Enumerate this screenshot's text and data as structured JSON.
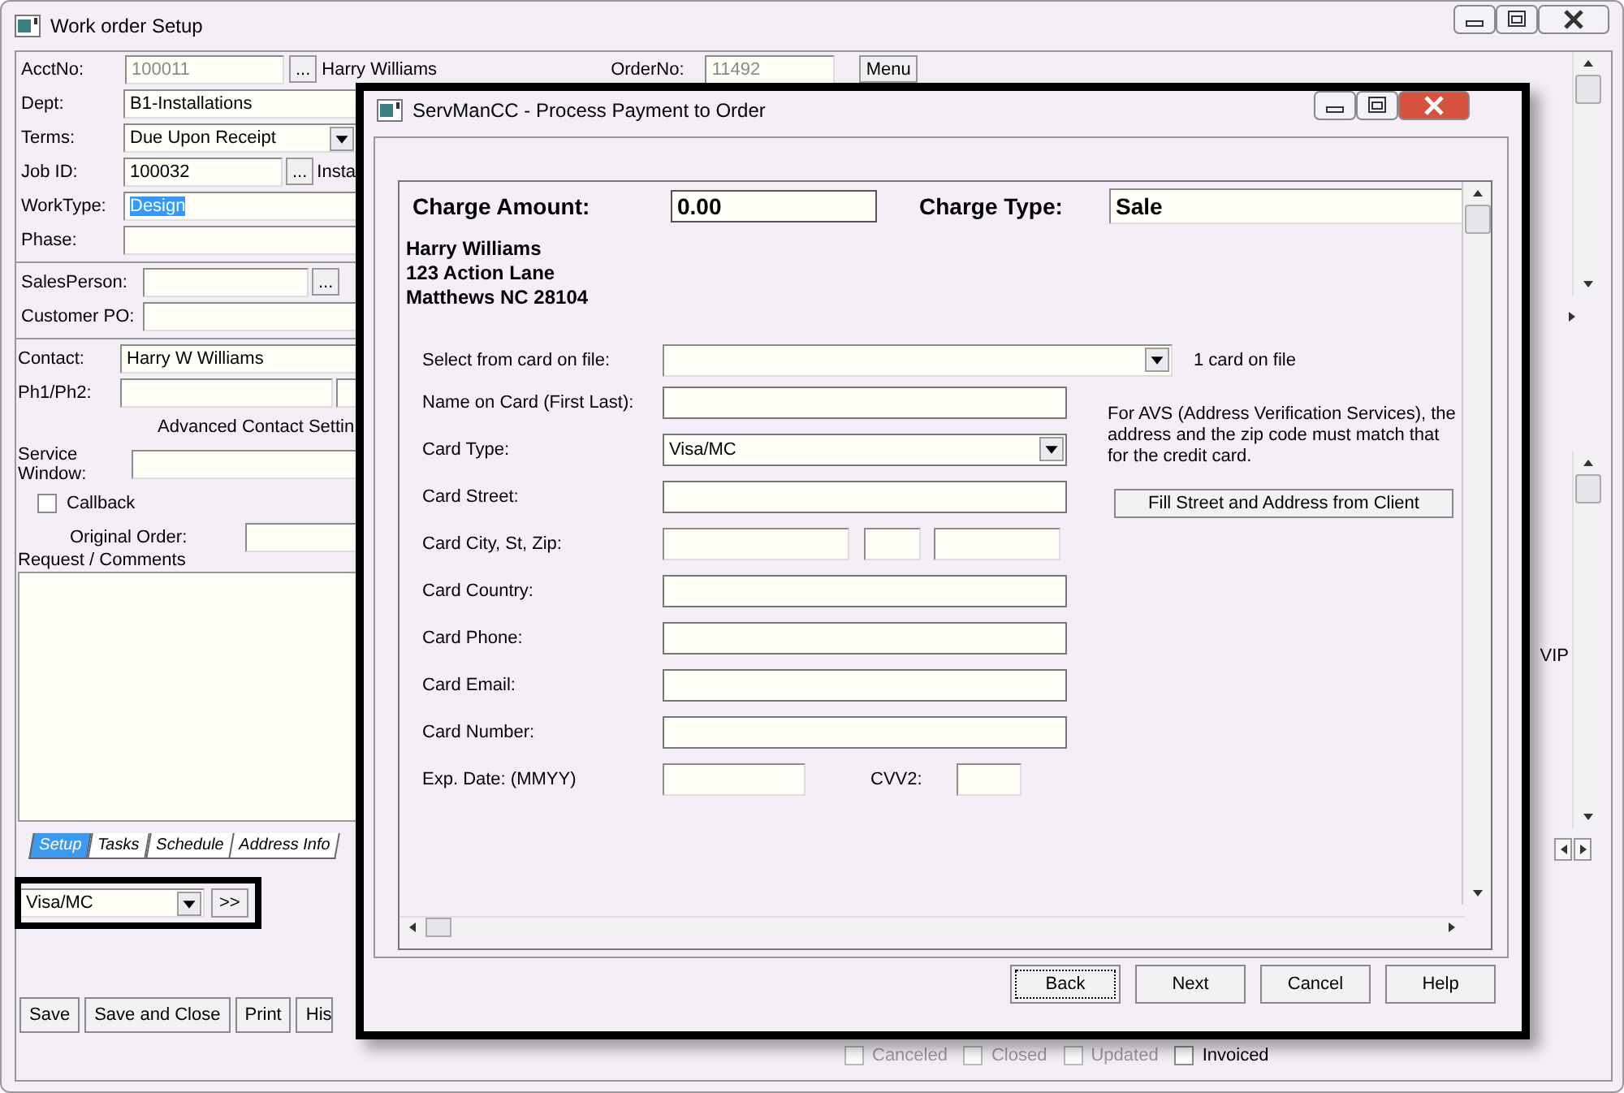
{
  "window": {
    "title": "Work order Setup"
  },
  "header": {
    "acct_label": "AcctNo:",
    "acct_value": "100011",
    "acct_disabled": true,
    "lookup_button": "...",
    "client_name": "Harry Williams",
    "order_label": "OrderNo:",
    "order_value": "11492",
    "order_disabled": true,
    "menu_button": "Menu"
  },
  "fields": [
    {
      "kind": "text",
      "label": "Dept:",
      "value": "B1-Installations"
    },
    {
      "kind": "dropdown",
      "label": "Terms:",
      "value": "Due Upon Receipt"
    },
    {
      "kind": "lookup",
      "label": "Job ID:",
      "value": "100032",
      "button": "...",
      "extra": "Insta"
    },
    {
      "kind": "text",
      "label": "WorkType:",
      "value": "Design",
      "highlighted": true
    },
    {
      "kind": "text",
      "label": "Phase:"
    }
  ],
  "sales_fields": [
    {
      "kind": "lookup",
      "label": "SalesPerson:",
      "button": "..."
    },
    {
      "kind": "text",
      "label": "Customer PO:"
    }
  ],
  "contact": {
    "label": "Contact:",
    "value": "Harry W Williams",
    "phone_label": "Ph1/Ph2:",
    "advanced_label": "Advanced Contact Settin",
    "service_label": "Service Window:",
    "callback": {
      "label": "Callback",
      "checked": false
    },
    "original_label": "Original Order:",
    "comments_label": "Request / Comments"
  },
  "tabs": [
    {
      "label": "Setup",
      "selected": true
    },
    {
      "label": "Tasks",
      "selected": false
    },
    {
      "label": "Schedule",
      "selected": false
    },
    {
      "label": "Address Info",
      "selected": false
    }
  ],
  "payment_method": {
    "value": "Visa/MC",
    "button": ">>"
  },
  "buttons": [
    {
      "label": "Save"
    },
    {
      "label": "Save and Close"
    },
    {
      "label": "Print"
    },
    {
      "label": "His"
    }
  ],
  "side_label": "VIP",
  "status_flags": [
    {
      "label": "Canceled",
      "checked": false,
      "disabled": true
    },
    {
      "label": "Closed",
      "checked": false,
      "disabled": true
    },
    {
      "label": "Updated",
      "checked": false,
      "disabled": true
    },
    {
      "label": "Invoiced",
      "checked": false,
      "disabled": false
    }
  ],
  "dialog": {
    "title": "ServManCC - Process Payment to Order",
    "charge_amount": {
      "label": "Charge Amount:",
      "value": "0.00"
    },
    "charge_type": {
      "label": "Charge Type:",
      "value": "Sale"
    },
    "address": [
      "Harry Williams",
      "123 Action Lane",
      "Matthews NC 28104"
    ],
    "card_select": {
      "label": "Select from card on file:",
      "note": "1 card on file"
    },
    "card_fields": [
      {
        "kind": "text",
        "label": "Name on Card (First Last):"
      },
      {
        "kind": "dropdown",
        "label": "Card Type:",
        "value": "Visa/MC"
      },
      {
        "kind": "text",
        "label": "Card Street:"
      },
      {
        "kind": "city",
        "label": "Card City, St, Zip:"
      },
      {
        "kind": "text",
        "label": "Card Country:"
      },
      {
        "kind": "text",
        "label": "Card Phone:"
      },
      {
        "kind": "text",
        "label": "Card Email:"
      },
      {
        "kind": "text",
        "label": "Card Number:"
      },
      {
        "kind": "expiry",
        "label": "Exp. Date: (MMYY)",
        "cvv_label": "CVV2:"
      }
    ],
    "avs_note": "For AVS (Address Verification Services), the address and the zip code must match that for the credit card.",
    "fill_button": "Fill Street and Address from Client",
    "buttons": [
      {
        "label": "Back",
        "focused": true
      },
      {
        "label": "Next",
        "focused": false
      },
      {
        "label": "Cancel",
        "focused": false
      },
      {
        "label": "Help",
        "focused": false
      }
    ]
  }
}
